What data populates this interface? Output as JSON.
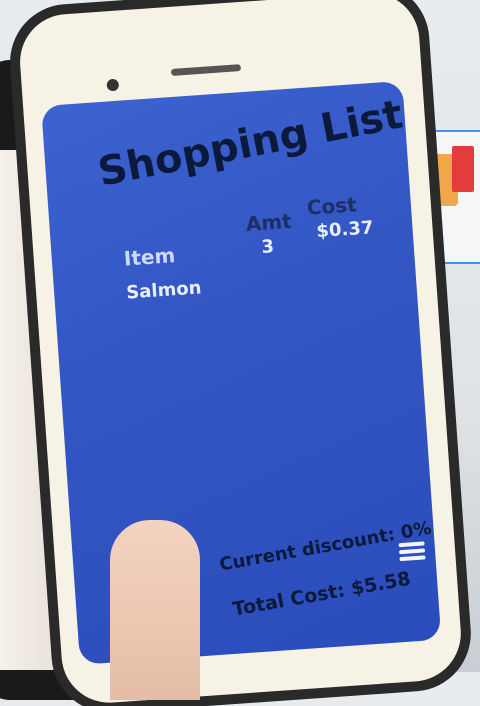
{
  "app": {
    "title": "Shopping List",
    "columns": {
      "item": "Item",
      "amount": "Amt",
      "cost": "Cost"
    },
    "items": [
      {
        "name": "Salmon",
        "amount": "3",
        "cost": "$0.37"
      }
    ],
    "current_discount": "Current discount: 0%",
    "total_cost": "Total Cost: $5.58",
    "menu_icon": "hamburger-menu-icon"
  }
}
